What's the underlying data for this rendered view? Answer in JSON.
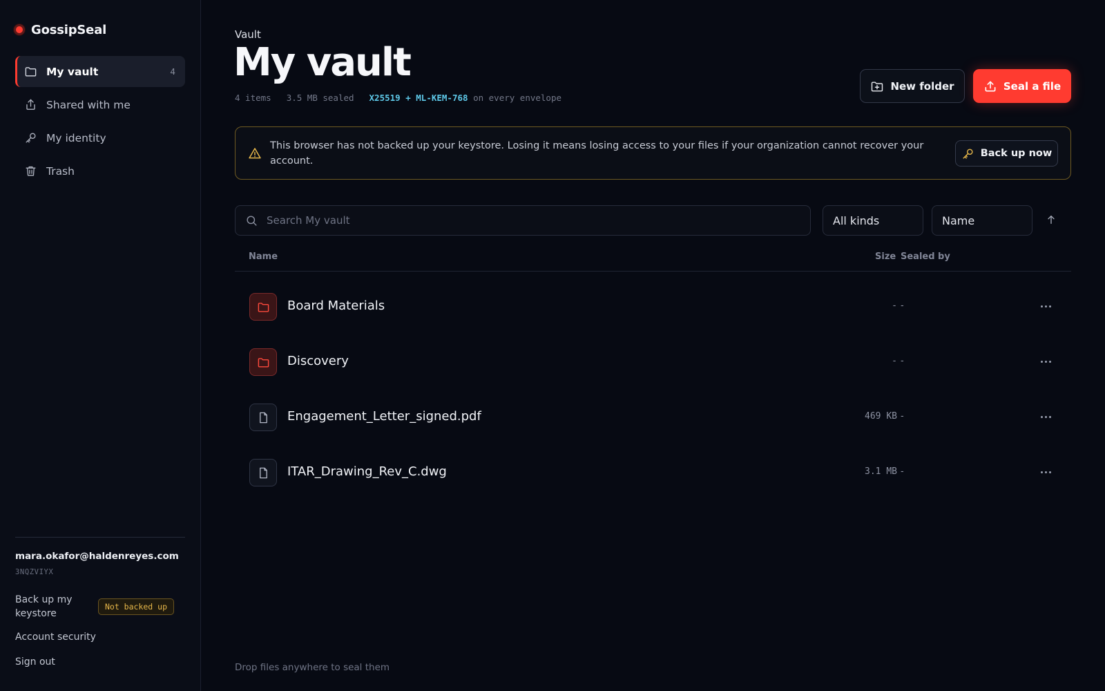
{
  "app": {
    "name": "GossipSeal"
  },
  "colors": {
    "accent": "#ff3b30",
    "warning": "#e8b84a",
    "algo": "#5ec8e8"
  },
  "sidebar": {
    "items": [
      {
        "label": "My vault",
        "icon": "folder-icon",
        "count": "4",
        "active": true
      },
      {
        "label": "Shared with me",
        "icon": "share-icon"
      },
      {
        "label": "My identity",
        "icon": "key-icon"
      },
      {
        "label": "Trash",
        "icon": "trash-icon"
      }
    ],
    "user": {
      "email": "mara.okafor@haldenreyes.com",
      "id": "3NQZVIYX"
    },
    "backup": {
      "label": "Back up my keystore",
      "status": "Not backed up"
    },
    "account_security": "Account security",
    "sign_out": "Sign out"
  },
  "header": {
    "breadcrumb": "Vault",
    "title": "My vault",
    "meta": {
      "items": "4 items",
      "size": "3.5 MB sealed",
      "algo": "X25519 + ML-KEM-768",
      "algo_suffix": "on every envelope"
    },
    "new_folder": "New folder",
    "seal_file": "Seal a file"
  },
  "alert": {
    "text": "This browser has not backed up your keystore. Losing it means losing access to your files if your organization cannot recover your account.",
    "button": "Back up now"
  },
  "filters": {
    "search_placeholder": "Search My vault",
    "kind": "All kinds",
    "sort": "Name"
  },
  "table": {
    "columns": {
      "name": "Name",
      "size": "Size",
      "sealed_by": "Sealed by"
    },
    "rows": [
      {
        "name": "Board Materials",
        "kind": "folder",
        "size": "-",
        "sealed_by": "-"
      },
      {
        "name": "Discovery",
        "kind": "folder",
        "size": "-",
        "sealed_by": "-"
      },
      {
        "name": "Engagement_Letter_signed.pdf",
        "kind": "file",
        "size": "469 KB",
        "sealed_by": "-"
      },
      {
        "name": "ITAR_Drawing_Rev_C.dwg",
        "kind": "file",
        "size": "3.1 MB",
        "sealed_by": "-"
      }
    ]
  },
  "footer": {
    "drop_hint": "Drop files anywhere to seal them"
  }
}
